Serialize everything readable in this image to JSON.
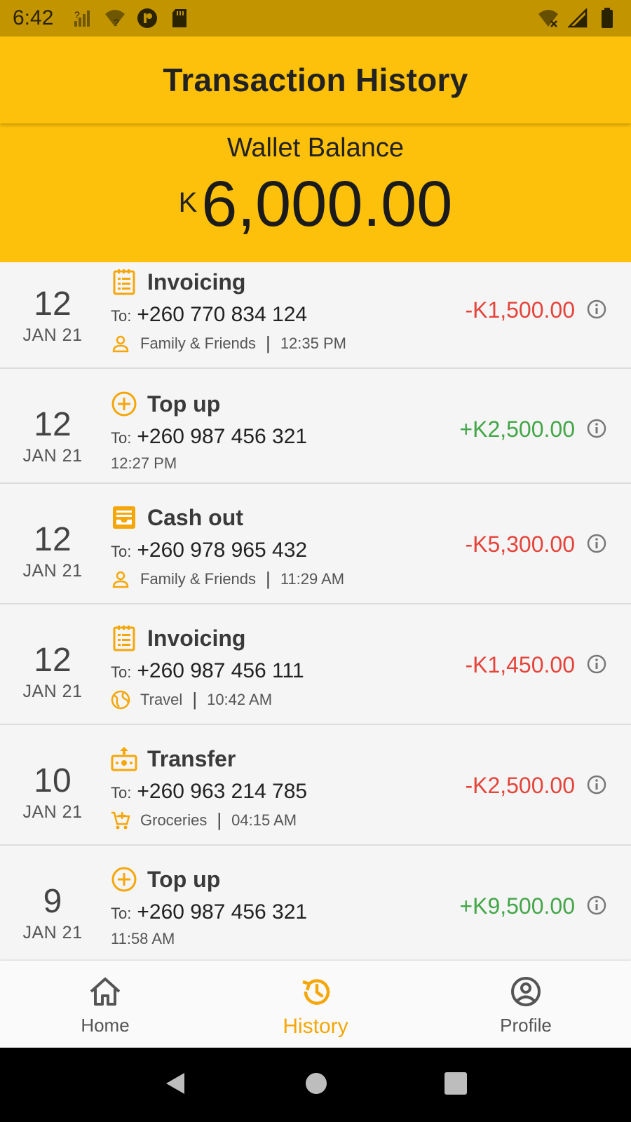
{
  "status_bar": {
    "time": "6:42"
  },
  "app_bar": {
    "title": "Transaction History"
  },
  "wallet": {
    "label": "Wallet Balance",
    "currency": "K",
    "balance": "6,000.00"
  },
  "transactions": [
    {
      "day": "12",
      "month": "JAN 21",
      "type": "Invoicing",
      "type_icon": "invoice-icon",
      "to_label": "To:",
      "phone": "+260 770 834 124",
      "category": "Family & Friends",
      "category_icon": "person-icon",
      "time": "12:35 PM",
      "amount": "-K1,500.00",
      "direction": "debit"
    },
    {
      "day": "12",
      "month": "JAN 21",
      "type": "Top up",
      "type_icon": "plus-circle-icon",
      "to_label": "To:",
      "phone": "+260 987 456 321",
      "category": "",
      "category_icon": "",
      "time": "12:27 PM",
      "amount": "+K2,500.00",
      "direction": "credit"
    },
    {
      "day": "12",
      "month": "JAN 21",
      "type": "Cash out",
      "type_icon": "cash-out-icon",
      "to_label": "To:",
      "phone": "+260 978 965 432",
      "category": "Family & Friends",
      "category_icon": "person-icon",
      "time": "11:29 AM",
      "amount": "-K5,300.00",
      "direction": "debit"
    },
    {
      "day": "12",
      "month": "JAN 21",
      "type": "Invoicing",
      "type_icon": "invoice-icon",
      "to_label": "To:",
      "phone": "+260 987 456 111",
      "category": "Travel",
      "category_icon": "globe-icon",
      "time": "10:42 AM",
      "amount": "-K1,450.00",
      "direction": "debit"
    },
    {
      "day": "10",
      "month": "JAN 21",
      "type": "Transfer",
      "type_icon": "transfer-icon",
      "to_label": "To:",
      "phone": "+260 963 214 785",
      "category": "Groceries",
      "category_icon": "cart-icon",
      "time": "04:15 AM",
      "amount": "-K2,500.00",
      "direction": "debit"
    },
    {
      "day": "9",
      "month": "JAN 21",
      "type": "Top up",
      "type_icon": "plus-circle-icon",
      "to_label": "To:",
      "phone": "+260 987 456 321",
      "category": "",
      "category_icon": "",
      "time": "11:58 AM",
      "amount": "+K9,500.00",
      "direction": "credit"
    }
  ],
  "bottom_nav": {
    "items": [
      {
        "label": "Home",
        "icon": "home-icon",
        "active": false
      },
      {
        "label": "History",
        "icon": "history-icon",
        "active": true
      },
      {
        "label": "Profile",
        "icon": "profile-icon",
        "active": false
      }
    ]
  },
  "colors": {
    "primary": "#fdc10b",
    "status_bar": "#c19400",
    "debit": "#e5443b",
    "credit": "#43a648",
    "accent_icon": "#f5a70a"
  }
}
